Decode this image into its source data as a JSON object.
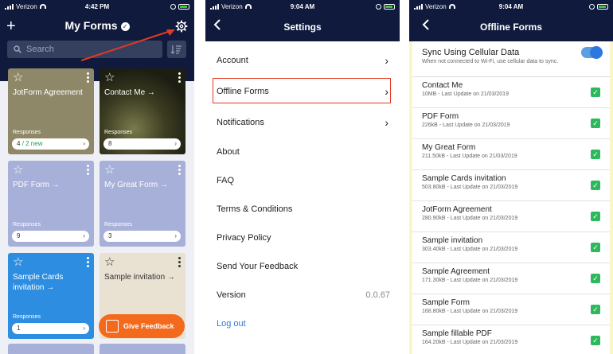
{
  "screen1": {
    "status": {
      "carrier": "Verizon",
      "time": "4:42 PM"
    },
    "title": "My Forms",
    "search_placeholder": "Search",
    "cards": [
      {
        "title": "JotForm Agreement",
        "responses_label": "Responses",
        "responses_count": "4",
        "responses_new": "/ 2 new"
      },
      {
        "title": "Contact Me →",
        "responses_label": "Responses",
        "responses_count": "8"
      },
      {
        "title": "PDF Form →",
        "responses_label": "Responses",
        "responses_count": "9"
      },
      {
        "title": "My Great Form →",
        "responses_label": "Responses",
        "responses_count": "3"
      },
      {
        "title": "Sample Cards invitation →",
        "responses_label": "Responses",
        "responses_count": "1"
      },
      {
        "title": "Sample invitation →"
      }
    ],
    "feedback_button": "Give Feedback"
  },
  "screen2": {
    "status": {
      "carrier": "Verizon",
      "time": "9:04 AM"
    },
    "title": "Settings",
    "items": [
      {
        "label": "Account"
      },
      {
        "label": "Offline Forms"
      },
      {
        "label": "Notifications"
      },
      {
        "label": "About"
      },
      {
        "label": "FAQ"
      },
      {
        "label": "Terms & Conditions"
      },
      {
        "label": "Privacy Policy"
      },
      {
        "label": "Send Your Feedback"
      },
      {
        "label": "Version",
        "value": "0.0.67"
      },
      {
        "label": "Log out"
      }
    ]
  },
  "screen3": {
    "status": {
      "carrier": "Verizon",
      "time": "9:04 AM"
    },
    "title": "Offline Forms",
    "sync": {
      "title": "Sync Using Cellular Data",
      "subtitle": "When not connected to Wi-Fi, use cellular data to sync.",
      "enabled": true
    },
    "forms": [
      {
        "name": "Contact Me",
        "meta": "10MB - Last Update on 21/03/2019"
      },
      {
        "name": "PDF Form",
        "meta": "226kB - Last Update on 21/03/2019"
      },
      {
        "name": "My Great Form",
        "meta": "211.50kB - Last Update on 21/03/2019"
      },
      {
        "name": "Sample Cards invitation",
        "meta": "503.80kB - Last Update on 21/03/2019"
      },
      {
        "name": "JotForm Agreement",
        "meta": "280.90kB - Last Update on 21/03/2019"
      },
      {
        "name": "Sample invitation",
        "meta": "303.40kB - Last Update on 21/03/2019"
      },
      {
        "name": "Sample Agreement",
        "meta": "171.30kB - Last Update on 21/03/2019"
      },
      {
        "name": "Sample Form",
        "meta": "168.80kB - Last Update on 21/03/2019"
      },
      {
        "name": "Sample fillable PDF",
        "meta": "164.20kB - Last Update on 21/03/2019"
      }
    ]
  },
  "colors": {
    "navbar": "#0f1a3d",
    "accent_orange": "#f46a1d",
    "highlight_red": "#e23a25",
    "link_blue": "#2d78d0",
    "check_green": "#2eb85c"
  }
}
